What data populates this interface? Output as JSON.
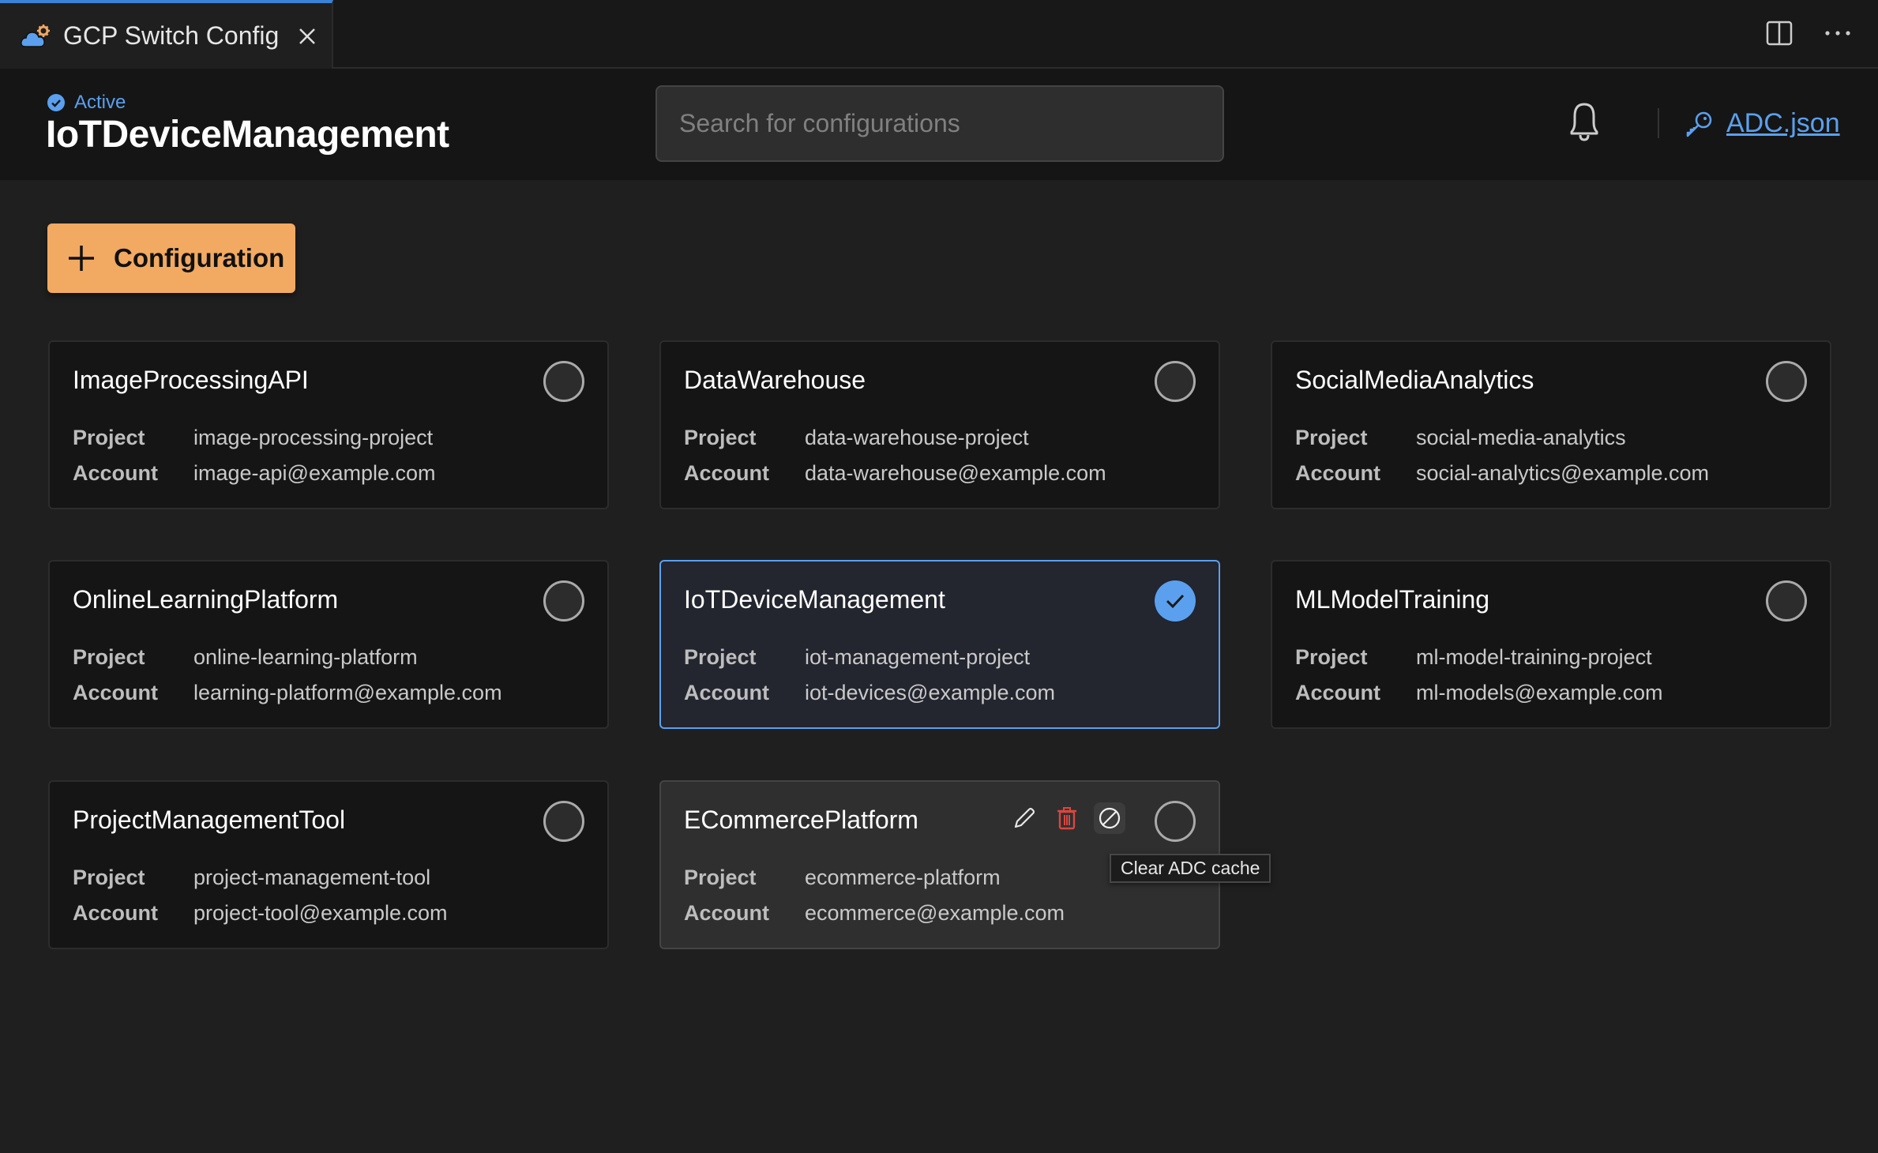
{
  "tab": {
    "title": "GCP Switch Config",
    "icon": "cloud-gear-icon",
    "close_icon": "close-icon"
  },
  "tab_actions": {
    "split_icon": "split-editor-icon",
    "more_icon": "more-actions-icon"
  },
  "header": {
    "status_label": "Active",
    "active_config": "IoTDeviceManagement",
    "search_placeholder": "Search for configurations",
    "search_value": "",
    "bell_icon": "bell-icon",
    "adc_link": "ADC.json",
    "adc_icon": "key-icon"
  },
  "add_button": {
    "label": "Configuration",
    "icon": "plus-icon"
  },
  "labels": {
    "project": "Project",
    "account": "Account"
  },
  "colors": {
    "accent": "#5aa0ee",
    "add_button": "#f2a962",
    "delete": "#d9473f",
    "background": "#1f1f1f",
    "card": "#151515"
  },
  "configs": [
    {
      "name": "ImageProcessingAPI",
      "project": "image-processing-project",
      "account": "image-api@example.com",
      "selected": false
    },
    {
      "name": "DataWarehouse",
      "project": "data-warehouse-project",
      "account": "data-warehouse@example.com",
      "selected": false
    },
    {
      "name": "SocialMediaAnalytics",
      "project": "social-media-analytics",
      "account": "social-analytics@example.com",
      "selected": false
    },
    {
      "name": "OnlineLearningPlatform",
      "project": "online-learning-platform",
      "account": "learning-platform@example.com",
      "selected": false
    },
    {
      "name": "IoTDeviceManagement",
      "project": "iot-management-project",
      "account": "iot-devices@example.com",
      "selected": true
    },
    {
      "name": "MLModelTraining",
      "project": "ml-model-training-project",
      "account": "ml-models@example.com",
      "selected": false
    },
    {
      "name": "ProjectManagementTool",
      "project": "project-management-tool",
      "account": "project-tool@example.com",
      "selected": false
    },
    {
      "name": "ECommercePlatform",
      "project": "ecommerce-platform",
      "account": "ecommerce@example.com",
      "selected": false,
      "hovered": true
    }
  ],
  "hover_actions": {
    "edit_icon": "pencil-icon",
    "delete_icon": "trash-icon",
    "clear_cache_icon": "clear-cache-icon"
  },
  "tooltip": "Clear ADC cache"
}
